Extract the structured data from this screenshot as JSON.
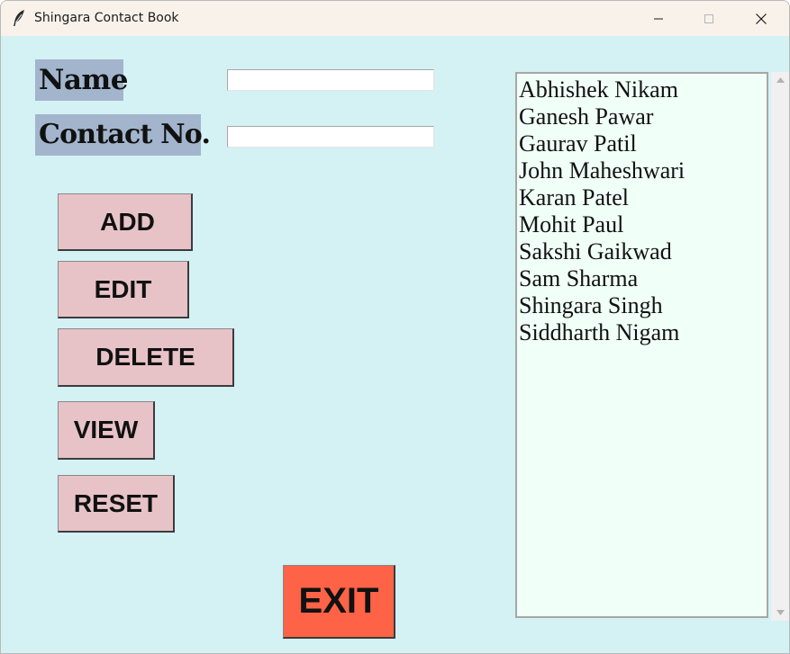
{
  "window": {
    "title": "Shingara Contact Book",
    "icon": "feather-icon"
  },
  "form": {
    "name_label": "Name",
    "contact_label": "Contact No.",
    "name_value": "",
    "contact_value": ""
  },
  "buttons": {
    "add": "ADD",
    "edit": "EDIT",
    "delete": "DELETE",
    "view": "VIEW",
    "reset": "RESET",
    "exit": "EXIT"
  },
  "contacts": [
    "Abhishek Nikam",
    "Ganesh Pawar",
    "Gaurav Patil",
    "John Maheshwari",
    "Karan Patel",
    "Mohit Paul",
    "Sakshi Gaikwad",
    "Sam Sharma",
    "Shingara Singh",
    "Siddharth Nigam"
  ],
  "colors": {
    "background": "#d4f1f4",
    "label_bg": "#a2b5cd",
    "button_bg": "#e7c3c8",
    "exit_bg": "#ff6347",
    "list_bg": "#f0fff8"
  }
}
